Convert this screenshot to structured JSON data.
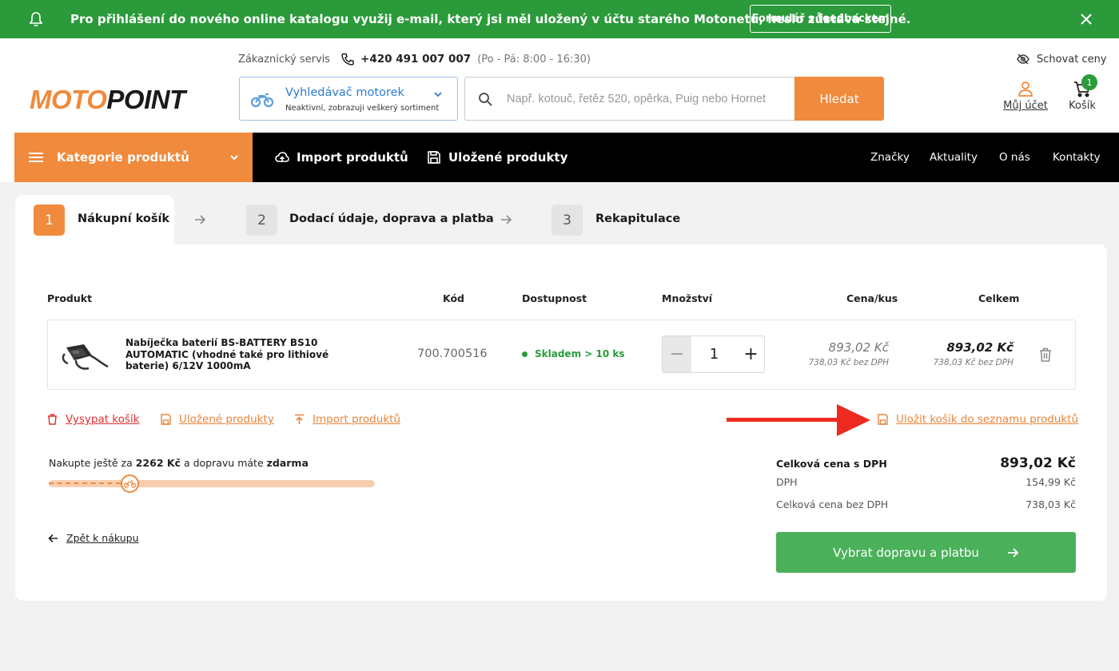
{
  "banner": {
    "message": "Pro přihlášení do nového online katalogu využij e-mail, který jsi měl uložený v účtu starého Motonetu, heslo zůstává stejné.",
    "feedback_button": "Formulář s feedbackem",
    "color": "#2a9a3a"
  },
  "header": {
    "logo_part1": "MOTO",
    "logo_part2": "POINT",
    "customer_service_label": "Zákaznický servis",
    "phone": "+420 491 007 007",
    "hours": "(Po - Pá: 8:00 - 16:30)",
    "hide_prices": "Schovat ceny",
    "moto_finder": {
      "title": "Vyhledávač motorek",
      "subtitle": "Neaktivní, zobrazuji veškerý sortiment"
    },
    "search": {
      "placeholder": "Např. kotouč, řetěz 520, opěrka, Puig nebo Hornet",
      "value": "",
      "button": "Hledat"
    },
    "account_label": "Můj účet",
    "cart_label": "Košík",
    "cart_count": "1"
  },
  "nav": {
    "categories": "Kategorie produktů",
    "import": "Import produktů",
    "saved": "Uložené produkty",
    "links": [
      "Značky",
      "Aktuality",
      "O nás",
      "Kontakty"
    ]
  },
  "steps": [
    {
      "num": "1",
      "label": "Nákupní košík",
      "active": true
    },
    {
      "num": "2",
      "label": "Dodací údaje, doprava a platba",
      "active": false
    },
    {
      "num": "3",
      "label": "Rekapitulace",
      "active": false
    }
  ],
  "table": {
    "headers": {
      "product": "Produkt",
      "code": "Kód",
      "availability": "Dostupnost",
      "quantity": "Množství",
      "unit_price": "Cena/kus",
      "total": "Celkem"
    },
    "rows": [
      {
        "name": "Nabíječka baterií BS-BATTERY BS10 AUTOMATIC (vhodné také pro lithiové baterie) 6/12V 1000mA",
        "code": "700.700516",
        "availability": "Skladem > 10 ks",
        "quantity": "1",
        "unit_price": "893,02 Kč",
        "unit_price_net": "738,03 Kč bez DPH",
        "total": "893,02 Kč",
        "total_net": "738,03 Kč bez DPH"
      }
    ]
  },
  "actions": {
    "empty_cart": "Vysypat košík",
    "saved_products": "Uložené produkty",
    "import_products": "Import produktů",
    "save_cart": "Uložit košík do seznamu produktů"
  },
  "shipping": {
    "prefix": "Nakupte ještě za ",
    "amount": "2262 Kč",
    "middle": " a dopravu máte ",
    "free": "zdarma",
    "progress": 0.25
  },
  "back_link": "Zpět k nákupu",
  "summary": {
    "total_label": "Celková cena s DPH",
    "total_value": "893,02 Kč",
    "vat_label": "DPH",
    "vat_value": "154,99 Kč",
    "net_label": "Celková cena bez DPH",
    "net_value": "738,03 Kč"
  },
  "cta": "Vybrat dopravu a platbu",
  "colors": {
    "accent": "#f08a3c",
    "green": "#2a9a3a",
    "cta_green": "#4bb05a",
    "danger": "#e03030"
  }
}
